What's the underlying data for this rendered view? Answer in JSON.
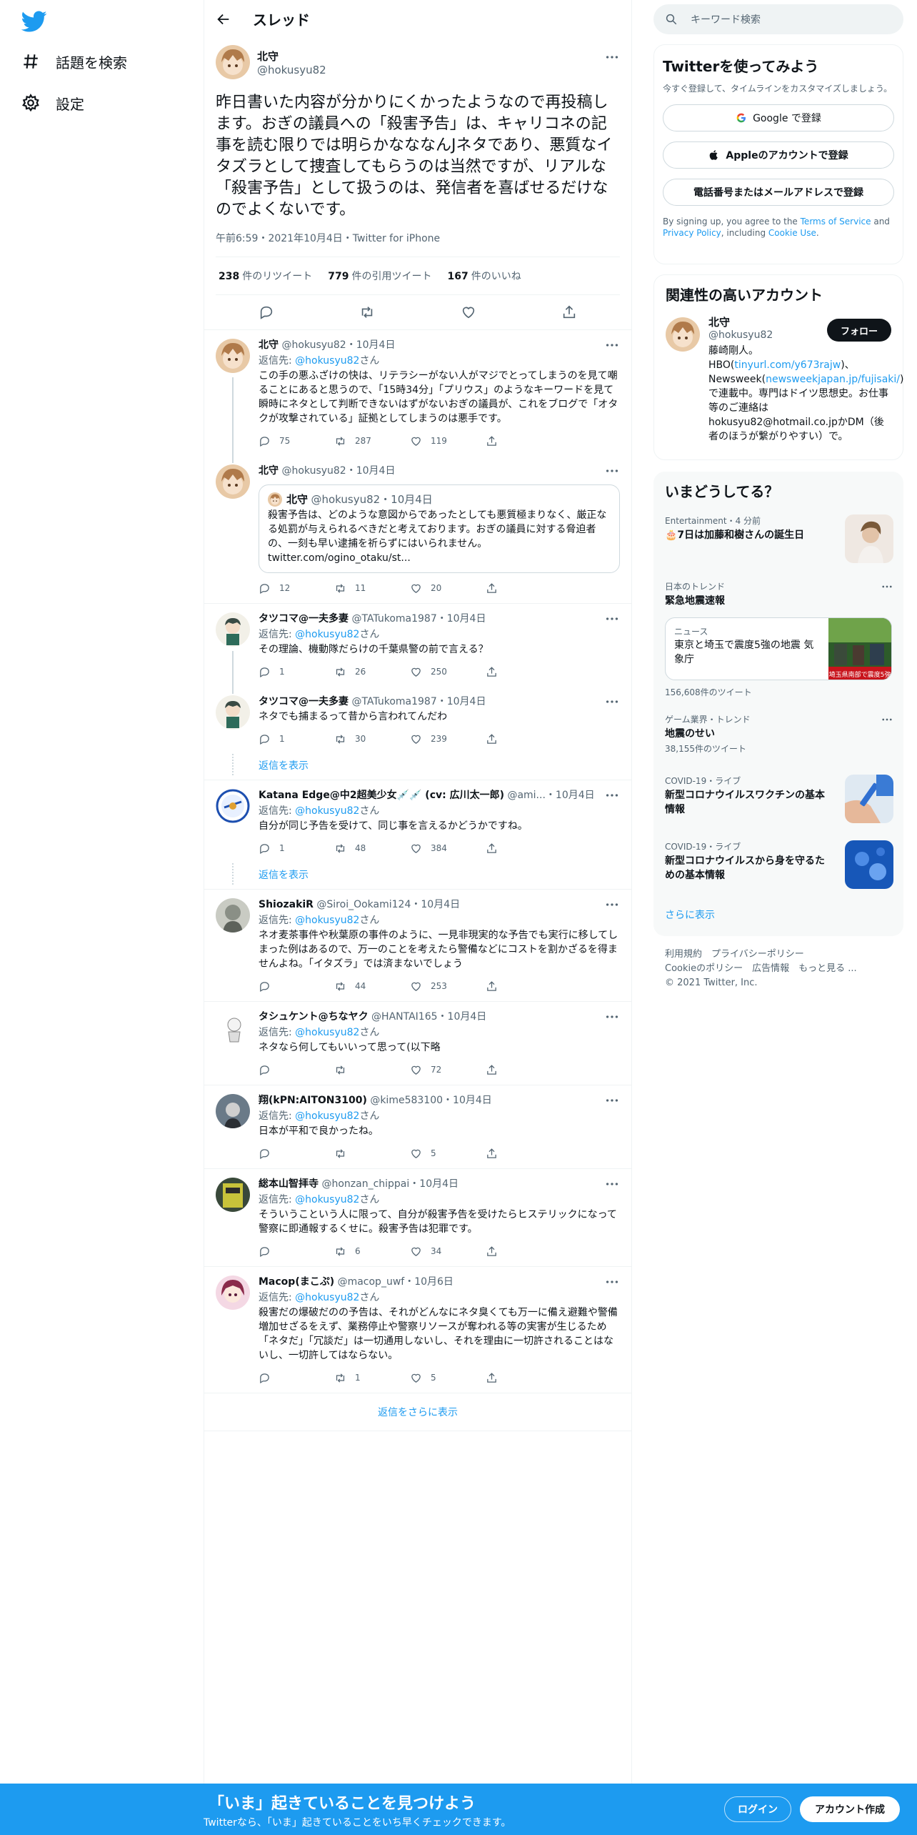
{
  "colors": {
    "accent": "#1d9bf0",
    "text": "#0f1419",
    "secondary": "#536471"
  },
  "nav": {
    "explore": "話題を検索",
    "settings": "設定"
  },
  "header": {
    "title": "スレッド"
  },
  "focal": {
    "name": "北守",
    "handle": "@hokusyu82",
    "text": "昨日書いた内容が分かりにくかったようなので再投稿します。おぎの議員への「殺害予告」は、キャリコネの記事を読む限りでは明らかなななんJネタであり、悪質なイタズラとして捜査してもらうのは当然ですが、リアルな「殺害予告」として扱うのは、発信者を喜ばせるだけなのでよくないです。",
    "meta": "午前6:59・2021年10月4日・Twitter for iPhone",
    "retweets": "238",
    "retweets_label": "件のリツイート",
    "quotes": "779",
    "quotes_label": "件の引用ツイート",
    "likes": "167",
    "likes_label": "件のいいね"
  },
  "replies": [
    {
      "name": "北守",
      "handle": "@hokusyu82",
      "date": "・10月4日",
      "replyto_prefix": "返信先: ",
      "replyto": "@hokusyu82",
      "replyto_suffix": "さん",
      "text": "この手の悪ふざけの快は、リテラシーがない人がマジでとってしまうのを見て嘲ることにあると思うので、「15時34分」「プリウス」のようなキーワードを見て瞬時にネタとして判断できないはずがないおぎの議員が、これをブログで「オタクが攻撃されている」証拠としてしまうのは悪手です。",
      "reply": "75",
      "rt": "287",
      "like": "119"
    },
    {
      "name": "北守",
      "handle": "@hokusyu82",
      "date": "・10月4日",
      "quote_name": "北守",
      "quote_handle": "@hokusyu82",
      "quote_date": "・10月4日",
      "quote_text": "殺害予告は、どのような意図からであったとしても悪質極まりなく、厳正なる処罰が与えられるべきだと考えております。おぎの議員に対する脅迫者の、一刻も早い逮捕を祈らずにはいられません。",
      "quote_link": "twitter.com/ogino_otaku/st...",
      "reply": "12",
      "rt": "11",
      "like": "20"
    },
    {
      "name": "タツコマ@一夫多妻",
      "handle": "@TATukoma1987",
      "date": "・10月4日",
      "replyto_prefix": "返信先: ",
      "replyto": "@hokusyu82",
      "replyto_suffix": "さん",
      "text": "その理論、機動隊だらけの千葉県警の前で言える？",
      "reply": "1",
      "rt": "26",
      "like": "250"
    },
    {
      "name": "タツコマ@一夫多妻",
      "handle": "@TATukoma1987",
      "date": "・10月4日",
      "text": "ネタでも捕まるって昔から言われてんだわ",
      "reply": "1",
      "rt": "30",
      "like": "239"
    },
    {
      "name": "Katana Edge@中2超美少女💉💉 (cv: 広川太一郎)",
      "handle": "@ami...",
      "date": "・10月4日",
      "replyto_prefix": "返信先: ",
      "replyto": "@hokusyu82",
      "replyto_suffix": "さん",
      "text": "自分が同じ予告を受けて、同じ事を言えるかどうかですね。",
      "reply": "1",
      "rt": "48",
      "like": "384"
    },
    {
      "name": "ShiozakiR",
      "handle": "@Siroi_Ookami124",
      "date": "・10月4日",
      "replyto_prefix": "返信先: ",
      "replyto": "@hokusyu82",
      "replyto_suffix": "さん",
      "text": "ネオ麦茶事件や秋葉原の事件のように、一見非現実的な予告でも実行に移してしまった例はあるので、万一のことを考えたら警備などにコストを割かざるを得ませんよね。「イタズラ」では済まないでしょう",
      "reply": "",
      "rt": "44",
      "like": "253"
    },
    {
      "name": "タシュケント@ちなヤク",
      "handle": "@HANTAI165",
      "date": "・10月4日",
      "replyto_prefix": "返信先: ",
      "replyto": "@hokusyu82",
      "replyto_suffix": "さん",
      "text": "ネタなら何してもいいって思って(以下略",
      "reply": "",
      "rt": "",
      "like": "72"
    },
    {
      "name": "翔(kPN:AITON3100)",
      "handle": "@kime583100",
      "date": "・10月4日",
      "replyto_prefix": "返信先: ",
      "replyto": "@hokusyu82",
      "replyto_suffix": "さん",
      "text": "日本が平和で良かったね。",
      "reply": "",
      "rt": "",
      "like": "5"
    },
    {
      "name": "総本山智拝寺",
      "handle": "@honzan_chippai",
      "date": "・10月4日",
      "replyto_prefix": "返信先: ",
      "replyto": "@hokusyu82",
      "replyto_suffix": "さん",
      "text": "そういうこという人に限って、自分が殺害予告を受けたらヒステリックになって警察に即通報するくせに。殺害予告は犯罪です。",
      "reply": "",
      "rt": "6",
      "like": "34"
    },
    {
      "name": "Macop(まこぷ)",
      "handle": "@macop_uwf",
      "date": "・10月6日",
      "replyto_prefix": "返信先: ",
      "replyto": "@hokusyu82",
      "replyto_suffix": "さん",
      "text": "殺害だの爆破だのの予告は、それがどんなにネタ臭くても万一に備え避難や警備増加せざるをえず、業務停止や警察リソースが奪われる等の実害が生じるため「ネタだ」「冗談だ」は一切通用しないし、それを理由に一切許されることはないし、一切許してはならない。",
      "reply": "",
      "rt": "1",
      "like": "5"
    }
  ],
  "show_replies_label": "返信を表示",
  "show_more_replies": "返信をさらに表示",
  "right": {
    "search_placeholder": "キーワード検索",
    "signup_title": "Twitterを使ってみよう",
    "signup_sub": "今すぐ登録して、タイムラインをカスタマイズしましょう。",
    "google_btn": "Google で登録",
    "apple_btn": "Appleのアカウントで登録",
    "phone_btn": "電話番号またはメールアドレスで登録",
    "legal_pre": "By signing up, you agree to the ",
    "legal_tos": "Terms of Service",
    "legal_and": " and ",
    "legal_pp": "Privacy Policy",
    "legal_inc": ", including ",
    "legal_cookie": "Cookie Use",
    "legal_end": ".",
    "related_title": "関連性の高いアカウント",
    "rel_name": "北守",
    "rel_handle": "@hokusyu82",
    "follow": "フォロー",
    "bio1": "藤崎剛人。",
    "bio2": "HBO(",
    "bio_link1": "tinyurl.com/y673rajw",
    "bio3": ")、Newsweek(",
    "bio_link2": "newsweekjapan.jp/fujisaki/",
    "bio4": ")で連載中。専門はドイツ思想史。お仕事等のご連絡はhokusyu82@hotmail.co.jpかDM（後者のほうが繋がりやすい）で。",
    "trends_title": "いまどうしてる？",
    "t1_ctx": "Entertainment・4 分前",
    "t1_title": "🎂7日は加藤和樹さんの誕生日",
    "t2_ctx": "日本のトレンド",
    "t2_title": "緊急地震速報",
    "news_ctx": "ニュース",
    "news_title": "東京と埼玉で震度5強の地震 気象庁",
    "news_img_text": "埼玉県南部で震度5強",
    "t2_count": "156,608件のツイート",
    "t3_ctx": "ゲーム業界・トレンド",
    "t3_title": "地震のせい",
    "t3_count": "38,155件のツイート",
    "t4_ctx": "COVID-19・ライブ",
    "t4_title": "新型コロナウイルスワクチンの基本情報",
    "t5_ctx": "COVID-19・ライブ",
    "t5_title": "新型コロナウイルスから身を守るための基本情報",
    "show_more": "さらに表示",
    "footer1": "利用規約　プライバシーポリシー",
    "footer2": "Cookieのポリシー　広告情報　もっと見る ...",
    "footer3": "© 2021 Twitter, Inc."
  },
  "bottom": {
    "title": "「いま」起きていることを見つけよう",
    "subtitle": "Twitterなら、「いま」起きていることをいち早くチェックできます。",
    "login": "ログイン",
    "signup": "アカウント作成"
  }
}
